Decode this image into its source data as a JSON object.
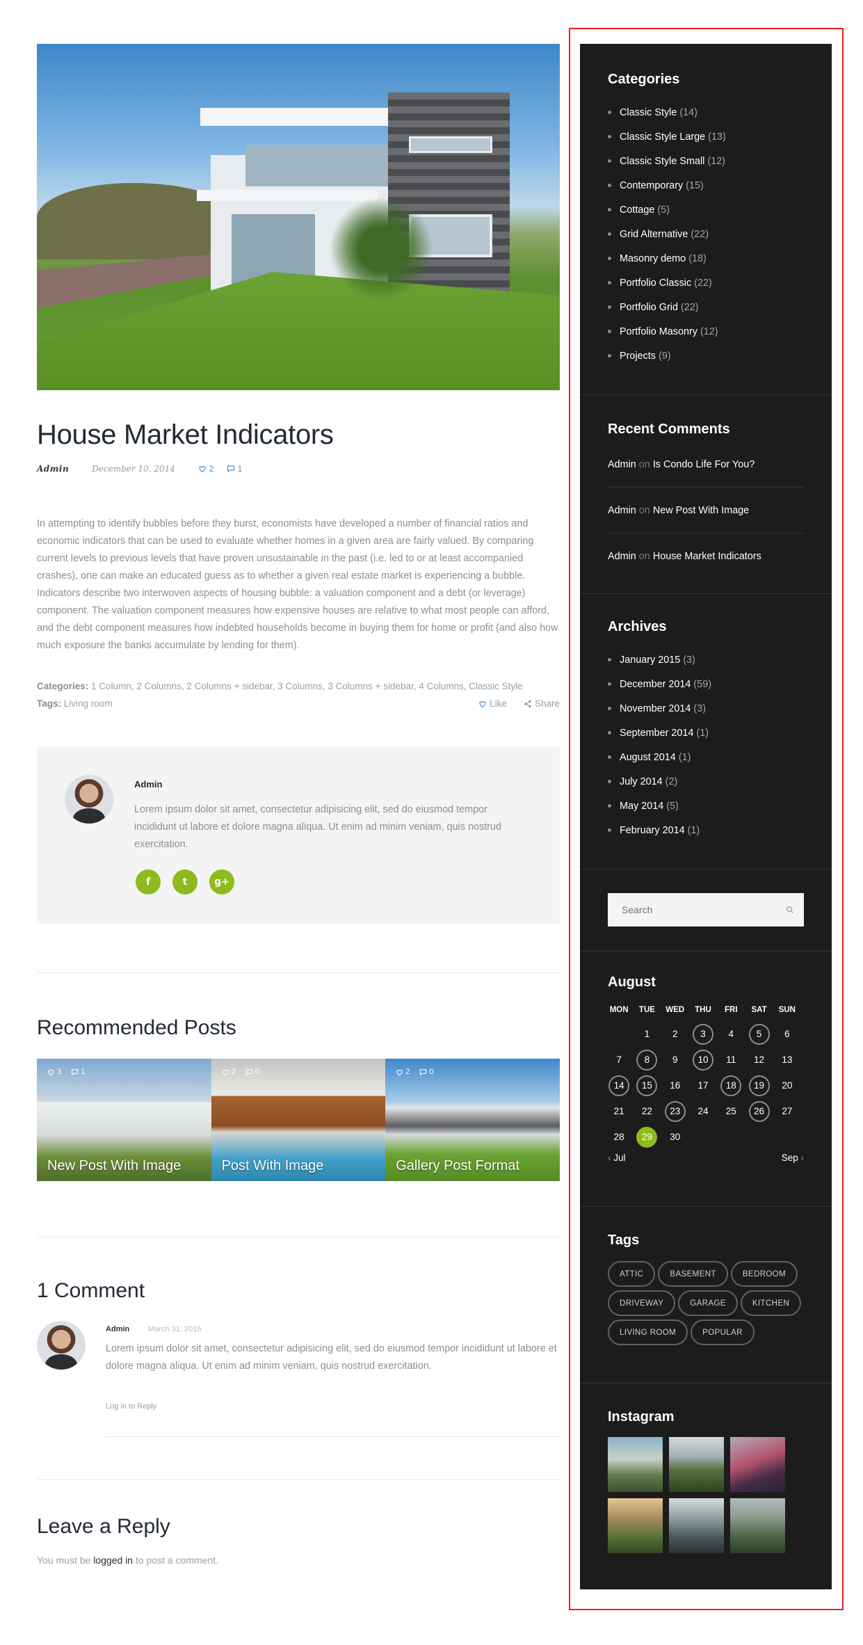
{
  "post": {
    "title": "House Market Indicators",
    "author": "Admin",
    "date": "December 10, 2014",
    "likes": "2",
    "comments": "1",
    "body": "In attempting to identify bubbles before they burst, economists have developed a number of financial ratios and economic indicators that can be used to evaluate whether homes in a given area are fairly valued. By comparing current levels to previous levels that have proven unsustainable in the past (i.e. led to or at least accompanied crashes), one can make an educated guess as to whether a given real estate market is experiencing a bubble. Indicators describe two interwoven aspects of housing bubble: a valuation component and a debt (or leverage) component. The valuation component measures how expensive houses are relative to what most people can afford, and the debt component measures how indebted households become in buying them for home or profit (and also how much exposure the banks accumulate by lending for them).",
    "categories_label": "Categories:",
    "categories": "1 Column, 2 Columns, 2 Columns + sidebar, 3 Columns, 3 Columns + sidebar, 4 Columns, Classic Style",
    "tags_label": "Tags:",
    "tags": "Living room",
    "like_label": "Like",
    "share_label": "Share"
  },
  "author_box": {
    "name": "Admin",
    "bio": "Lorem ipsum dolor sit amet, consectetur adipisicing elit, sed do eiusmod tempor incididunt ut labore et dolore magna aliqua. Ut enim ad minim veniam, quis nostrud exercitation.",
    "socials": [
      "f",
      "t",
      "g+"
    ]
  },
  "recommended": {
    "heading": "Recommended Posts",
    "items": [
      {
        "title": "New Post With Image",
        "likes": "3",
        "comments": "1"
      },
      {
        "title": "Post With Image",
        "likes": "2",
        "comments": "0"
      },
      {
        "title": "Gallery Post Format",
        "likes": "2",
        "comments": "0"
      }
    ]
  },
  "comments_section": {
    "heading": "1 Comment",
    "comment": {
      "author": "Admin",
      "date": "March 31, 2015",
      "text": "Lorem ipsum dolor sit amet, consectetur adipisicing elit, sed do eiusmod tempor incididunt ut labore et dolore magna aliqua. Ut enim ad minim veniam, quis nostrud exercitation.",
      "reply": "Log in to Reply"
    }
  },
  "reply": {
    "heading": "Leave a Reply",
    "text_before": "You must be",
    "link": "logged in",
    "text_after": "to post a comment."
  },
  "sidebar": {
    "categories": {
      "title": "Categories",
      "items": [
        {
          "label": "Classic Style",
          "count": "(14)"
        },
        {
          "label": "Classic Style Large",
          "count": "(13)"
        },
        {
          "label": "Classic Style Small",
          "count": "(12)"
        },
        {
          "label": "Contemporary",
          "count": "(15)"
        },
        {
          "label": "Cottage",
          "count": "(5)"
        },
        {
          "label": "Grid Alternative",
          "count": "(22)"
        },
        {
          "label": "Masonry demo",
          "count": "(18)"
        },
        {
          "label": "Portfolio Classic",
          "count": "(22)"
        },
        {
          "label": "Portfolio Grid",
          "count": "(22)"
        },
        {
          "label": "Portfolio Masonry",
          "count": "(12)"
        },
        {
          "label": "Projects",
          "count": "(9)"
        }
      ]
    },
    "recent_comments": {
      "title": "Recent Comments",
      "on_word": "on",
      "items": [
        {
          "author": "Admin",
          "post": "Is Condo Life For You?"
        },
        {
          "author": "Admin",
          "post": "New Post With Image"
        },
        {
          "author": "Admin",
          "post": "House Market Indicators"
        }
      ]
    },
    "archives": {
      "title": "Archives",
      "items": [
        {
          "label": "January 2015",
          "count": "(3)"
        },
        {
          "label": "December 2014",
          "count": "(59)"
        },
        {
          "label": "November 2014",
          "count": "(3)"
        },
        {
          "label": "September 2014",
          "count": "(1)"
        },
        {
          "label": "August 2014",
          "count": "(1)"
        },
        {
          "label": "July 2014",
          "count": "(2)"
        },
        {
          "label": "May 2014",
          "count": "(5)"
        },
        {
          "label": "February 2014",
          "count": "(1)"
        }
      ]
    },
    "search": {
      "placeholder": "Search"
    },
    "calendar": {
      "title": "August",
      "days": [
        "MON",
        "TUE",
        "WED",
        "THU",
        "FRI",
        "SAT",
        "SUN"
      ],
      "start_offset": 1,
      "num_days": 30,
      "event_days": [
        3,
        5,
        8,
        10,
        14,
        15,
        18,
        19,
        23,
        26
      ],
      "today": 29,
      "prev": "Jul",
      "next": "Sep",
      "accent": "#8dbb1d"
    },
    "tags": {
      "title": "Tags",
      "items": [
        "ATTIC",
        "BASEMENT",
        "BEDROOM",
        "DRIVEWAY",
        "GARAGE",
        "KITCHEN",
        "LIVING ROOM",
        "POPULAR"
      ]
    },
    "instagram": {
      "title": "Instagram"
    }
  }
}
